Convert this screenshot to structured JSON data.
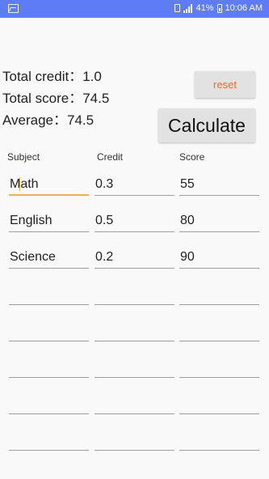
{
  "status_bar": {
    "battery_percent": "41%",
    "time": "10:06 AM"
  },
  "summary": {
    "total_credit_label": "Total credit：",
    "total_credit_value": "1.0",
    "total_score_label": "Total score：",
    "total_score_value": "74.5",
    "average_label": "Average：",
    "average_value": "74.5"
  },
  "buttons": {
    "reset": "reset",
    "calculate": "Calculate"
  },
  "columns": {
    "subject": "Subject",
    "credit": "Credit",
    "score": "Score"
  },
  "rows": [
    {
      "subject": "Math",
      "credit": "0.3",
      "score": "55"
    },
    {
      "subject": "English",
      "credit": "0.5",
      "score": "80"
    },
    {
      "subject": "Science",
      "credit": "0.2",
      "score": "90"
    },
    {
      "subject": "",
      "credit": "",
      "score": ""
    },
    {
      "subject": "",
      "credit": "",
      "score": ""
    },
    {
      "subject": "",
      "credit": "",
      "score": ""
    },
    {
      "subject": "",
      "credit": "",
      "score": ""
    },
    {
      "subject": "",
      "credit": "",
      "score": ""
    }
  ],
  "colors": {
    "status_bar": "#5f7cf7",
    "reset_text": "#f06b2c",
    "focus_underline": "#f3b33d"
  }
}
